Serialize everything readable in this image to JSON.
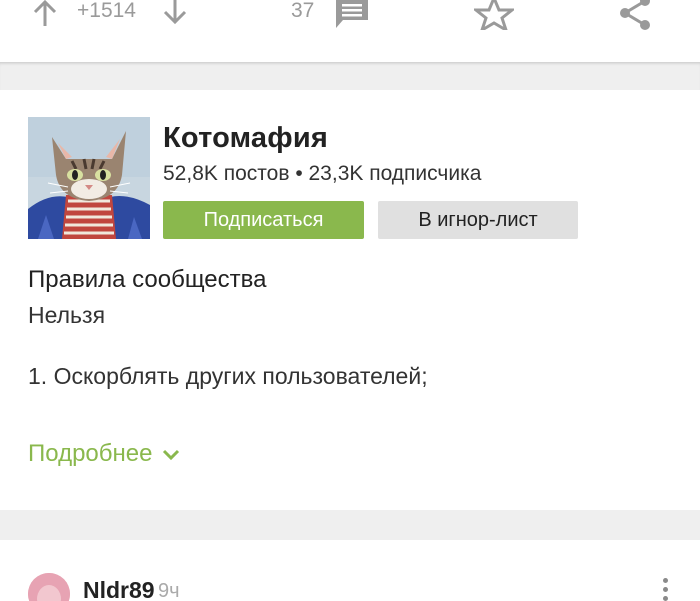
{
  "action_bar": {
    "rating": "+1514",
    "comments_count": "37",
    "icons": [
      "arrow-up-icon",
      "arrow-down-icon",
      "comment-icon",
      "star-icon",
      "share-icon"
    ]
  },
  "community": {
    "name": "Котомафия",
    "stats": "52,8K постов • 23,3K подписчика",
    "subscribe_label": "Подписаться",
    "ignore_label": "В игнор-лист",
    "rules_title": "Правила сообщества",
    "rules_lines": [
      "Нельзя",
      "1. Оскорблять других пользователей;"
    ],
    "more_label": "Подробнее"
  },
  "comment": {
    "username": "Nldr89",
    "time": "9ч"
  },
  "colors": {
    "accent": "#8ab84d",
    "ignore_button": "#e0e0e0",
    "separator": "#efefef"
  }
}
